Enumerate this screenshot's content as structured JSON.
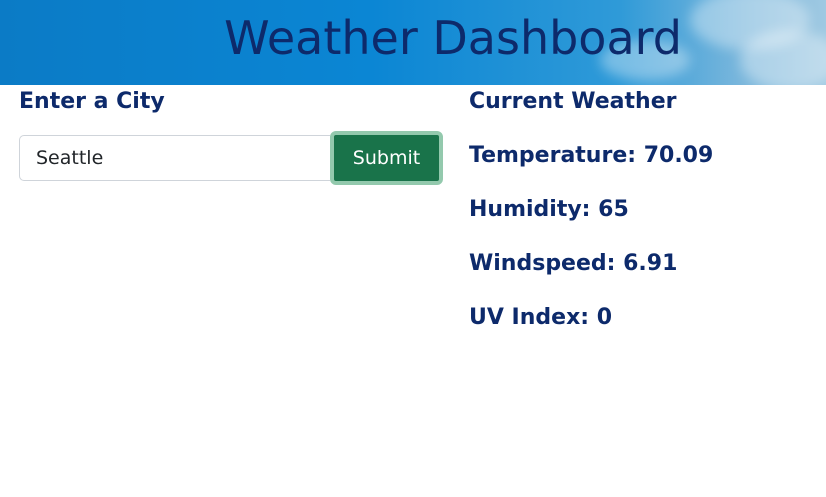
{
  "header": {
    "title": "Weather Dashboard"
  },
  "search": {
    "heading": "Enter a City",
    "input_value": "Seattle",
    "submit_label": "Submit"
  },
  "current": {
    "heading": "Current Weather",
    "temperature": "Temperature: 70.09",
    "humidity": "Humidity: 65",
    "windspeed": "Windspeed: 6.91",
    "uv_index": "UV Index: 0"
  },
  "colors": {
    "text_navy": "#0d2a6b",
    "header_blue": "#0b86d4",
    "button_green": "#19734a"
  }
}
